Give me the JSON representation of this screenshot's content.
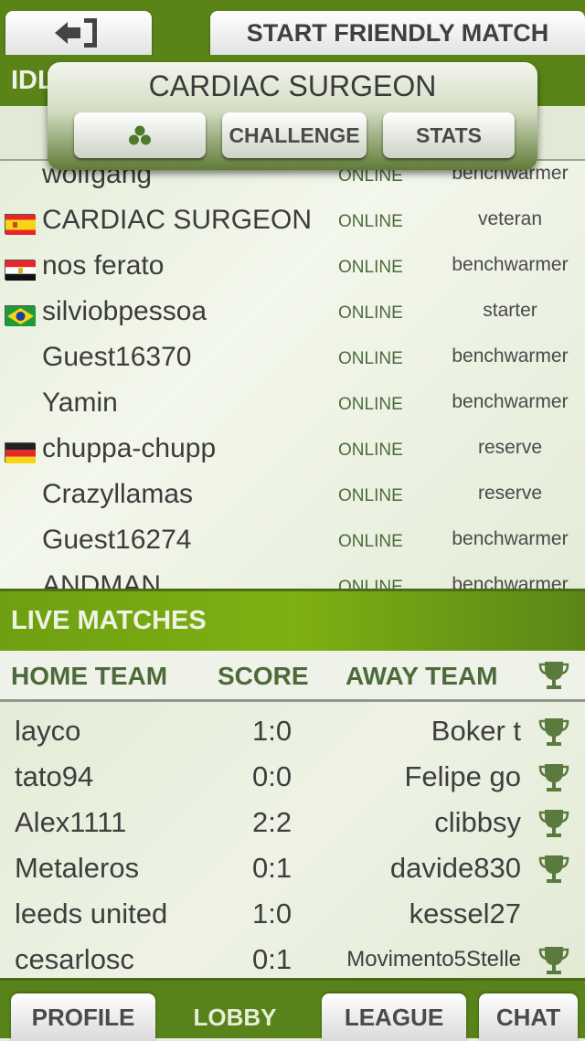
{
  "header": {
    "back_icon": "exit-arrow-icon",
    "start_friendly_match": "START FRIENDLY MATCH"
  },
  "idle": {
    "title": "IDLE"
  },
  "popup": {
    "title": "CARDIAC SURGEON",
    "team_icon": "three-balls-icon",
    "challenge": "CHALLENGE",
    "stats": "STATS"
  },
  "players": [
    {
      "name": "wolfgang",
      "status": "ONLINE",
      "rank": "benchwarmer",
      "flag": ""
    },
    {
      "name": "CARDIAC SURGEON",
      "status": "ONLINE",
      "rank": "veteran",
      "flag": "spain"
    },
    {
      "name": "nos ferato",
      "status": "ONLINE",
      "rank": "benchwarmer",
      "flag": "egypt"
    },
    {
      "name": "silviobpessoa",
      "status": "ONLINE",
      "rank": "starter",
      "flag": "brazil"
    },
    {
      "name": "Guest16370",
      "status": "ONLINE",
      "rank": "benchwarmer",
      "flag": ""
    },
    {
      "name": "Yamin",
      "status": "ONLINE",
      "rank": "benchwarmer",
      "flag": ""
    },
    {
      "name": "chuppa-chupp",
      "status": "ONLINE",
      "rank": "reserve",
      "flag": "germany"
    },
    {
      "name": "Crazyllamas",
      "status": "ONLINE",
      "rank": "reserve",
      "flag": ""
    },
    {
      "name": "Guest16274",
      "status": "ONLINE",
      "rank": "benchwarmer",
      "flag": ""
    },
    {
      "name": "ANDMAN",
      "status": "ONLINE",
      "rank": "benchwarmer",
      "flag": ""
    }
  ],
  "live": {
    "title": "LIVE MATCHES",
    "columns": {
      "home": "HOME TEAM",
      "score": "SCORE",
      "away": "AWAY TEAM",
      "trophy_icon": "trophy-icon"
    },
    "matches": [
      {
        "home": "layco",
        "score": "1:0",
        "away": "Boker t",
        "trophy": true
      },
      {
        "home": "tato94",
        "score": "0:0",
        "away": "Felipe go",
        "trophy": true
      },
      {
        "home": "Alex1111",
        "score": "2:2",
        "away": "clibbsy",
        "trophy": true
      },
      {
        "home": "Metaleros",
        "score": "0:1",
        "away": "davide830",
        "trophy": true
      },
      {
        "home": "leeds united",
        "score": "1:0",
        "away": "kessel27",
        "trophy": false
      },
      {
        "home": "cesarlosc",
        "score": "0:1",
        "away": "Movimento5Stelle",
        "trophy": true
      }
    ]
  },
  "tabs": {
    "profile": "PROFILE",
    "lobby": "LOBBY",
    "league": "LEAGUE",
    "chat": "CHAT"
  }
}
